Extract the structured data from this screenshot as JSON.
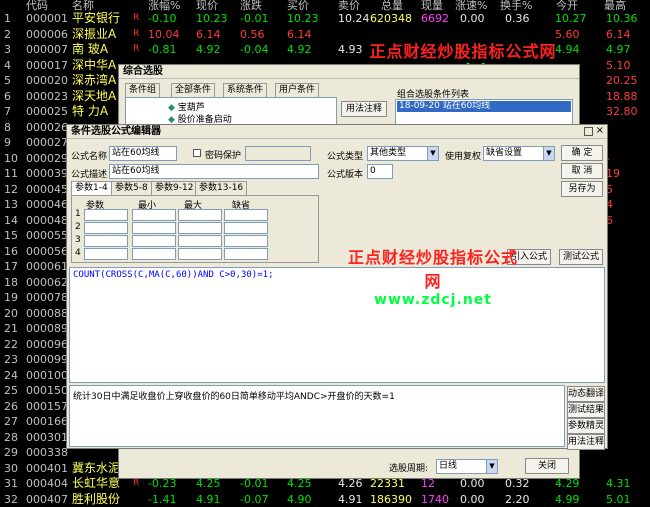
{
  "table": {
    "headers": [
      "代码",
      "名称",
      "涨幅%",
      "现价",
      "涨跌",
      "买价",
      "卖价",
      "总量",
      "现量",
      "涨速%",
      "换手%",
      "今开",
      "最高"
    ],
    "rows": [
      {
        "idx": "1",
        "code": "000001",
        "name": "平安银行",
        "r": "R",
        "chg": "-0.10",
        "price": "10.23",
        "diff": "-0.01",
        "bid": "10.23",
        "ask": "10.24",
        "vol": "620348",
        "cur": "6692",
        "spd": "0.00",
        "turn": "0.36",
        "open": "10.27",
        "high": "10.36"
      },
      {
        "idx": "2",
        "code": "000006",
        "name": "深振业A",
        "r": "R",
        "chg": "10.04",
        "price": "6.14",
        "diff": "0.56",
        "bid": "6.14",
        "ask": "",
        "vol": "",
        "cur": "",
        "spd": "",
        "turn": "",
        "open": "5.60",
        "high": "6.14"
      },
      {
        "idx": "3",
        "code": "000007",
        "name": "南 玻A",
        "r": "R",
        "chg": "-0.81",
        "price": "4.92",
        "diff": "-0.04",
        "bid": "4.92",
        "ask": "4.93",
        "vol": "",
        "cur": "",
        "spd": "",
        "turn": "",
        "open": "4.94",
        "high": "4.97"
      },
      {
        "idx": "4",
        "code": "000017",
        "name": "深中华A",
        "r": "",
        "chg": "",
        "price": "",
        "diff": "",
        "bid": "",
        "ask": "",
        "vol": "",
        "cur": "",
        "spd": "",
        "turn": "",
        "open": "",
        "high": "5.10"
      },
      {
        "idx": "5",
        "code": "000020",
        "name": "深赤湾A",
        "r": "",
        "chg": "",
        "price": "",
        "diff": "",
        "bid": "",
        "ask": "",
        "vol": "",
        "cur": "",
        "spd": "",
        "turn": "",
        "open": "",
        "high": "20.25"
      },
      {
        "idx": "6",
        "code": "000023",
        "name": "深天地A",
        "r": "",
        "chg": "",
        "price": "",
        "diff": "",
        "bid": "",
        "ask": "",
        "vol": "",
        "cur": "",
        "spd": "",
        "turn": "",
        "open": "",
        "high": "18.88"
      },
      {
        "idx": "7",
        "code": "000025",
        "name": "特 力A",
        "r": "",
        "chg": "",
        "price": "",
        "diff": "",
        "bid": "",
        "ask": "",
        "vol": "",
        "cur": "",
        "spd": "",
        "turn": "",
        "open": "",
        "high": "32.80"
      },
      {
        "idx": "8",
        "code": "000026",
        "name": "",
        "r": "",
        "chg": "",
        "price": "",
        "diff": "",
        "bid": "",
        "ask": "",
        "vol": "",
        "cur": "",
        "spd": "",
        "turn": "",
        "open": "",
        "high": ""
      },
      {
        "idx": "9",
        "code": "000027",
        "name": "",
        "r": "",
        "chg": "",
        "price": "",
        "diff": "",
        "bid": "",
        "ask": "",
        "vol": "",
        "cur": "",
        "spd": "",
        "turn": "",
        "open": "",
        "high": ""
      },
      {
        "idx": "10",
        "code": "000029",
        "name": "",
        "r": "",
        "chg": "",
        "price": "",
        "diff": "",
        "bid": "",
        "ask": "",
        "vol": "",
        "cur": "",
        "spd": "",
        "turn": "",
        "open": "",
        "high": "-"
      },
      {
        "idx": "11",
        "code": "000039",
        "name": "",
        "r": "",
        "chg": "",
        "price": "",
        "diff": "",
        "bid": "",
        "ask": "",
        "vol": "",
        "cur": "",
        "spd": "",
        "turn": "",
        "open": "",
        "high": "19"
      },
      {
        "idx": "12",
        "code": "000045",
        "name": "",
        "r": "",
        "chg": "",
        "price": "",
        "diff": "",
        "bid": "",
        "ask": "",
        "vol": "",
        "cur": "",
        "spd": "",
        "turn": "",
        "open": "",
        "high": "5"
      },
      {
        "idx": "13",
        "code": "000046",
        "name": "",
        "r": "",
        "chg": "",
        "price": "",
        "diff": "",
        "bid": "",
        "ask": "",
        "vol": "",
        "cur": "",
        "spd": "",
        "turn": "",
        "open": "",
        "high": "4"
      },
      {
        "idx": "14",
        "code": "000048",
        "name": "",
        "r": "",
        "chg": "",
        "price": "",
        "diff": "",
        "bid": "",
        "ask": "",
        "vol": "",
        "cur": "",
        "spd": "",
        "turn": "",
        "open": "",
        "high": "6"
      },
      {
        "idx": "15",
        "code": "000055",
        "name": "",
        "r": "",
        "chg": "",
        "price": "",
        "diff": "",
        "bid": "",
        "ask": "",
        "vol": "",
        "cur": "",
        "spd": "",
        "turn": "",
        "open": "",
        "high": ""
      },
      {
        "idx": "16",
        "code": "000056",
        "name": "",
        "r": "",
        "chg": "",
        "price": "",
        "diff": "",
        "bid": "",
        "ask": "",
        "vol": "",
        "cur": "",
        "spd": "",
        "turn": "",
        "open": "",
        "high": ""
      },
      {
        "idx": "17",
        "code": "000061",
        "name": "",
        "r": "",
        "chg": "",
        "price": "",
        "diff": "",
        "bid": "",
        "ask": "",
        "vol": "",
        "cur": "",
        "spd": "",
        "turn": "",
        "open": "",
        "high": ""
      },
      {
        "idx": "18",
        "code": "000062",
        "name": "",
        "r": "",
        "chg": "",
        "price": "",
        "diff": "",
        "bid": "",
        "ask": "",
        "vol": "",
        "cur": "",
        "spd": "",
        "turn": "",
        "open": "",
        "high": ""
      },
      {
        "idx": "19",
        "code": "000078",
        "name": "",
        "r": "",
        "chg": "",
        "price": "",
        "diff": "",
        "bid": "",
        "ask": "",
        "vol": "",
        "cur": "",
        "spd": "",
        "turn": "",
        "open": "",
        "high": ""
      },
      {
        "idx": "20",
        "code": "000088",
        "name": "",
        "r": "",
        "chg": "",
        "price": "",
        "diff": "",
        "bid": "",
        "ask": "",
        "vol": "",
        "cur": "",
        "spd": "",
        "turn": "",
        "open": "",
        "high": ""
      },
      {
        "idx": "21",
        "code": "000089",
        "name": "",
        "r": "",
        "chg": "",
        "price": "",
        "diff": "",
        "bid": "",
        "ask": "",
        "vol": "",
        "cur": "",
        "spd": "",
        "turn": "",
        "open": "",
        "high": ""
      },
      {
        "idx": "22",
        "code": "000096",
        "name": "",
        "r": "",
        "chg": "",
        "price": "",
        "diff": "",
        "bid": "",
        "ask": "",
        "vol": "",
        "cur": "",
        "spd": "",
        "turn": "",
        "open": "",
        "high": ""
      },
      {
        "idx": "23",
        "code": "000099",
        "name": "",
        "r": "",
        "chg": "",
        "price": "",
        "diff": "",
        "bid": "",
        "ask": "",
        "vol": "",
        "cur": "",
        "spd": "",
        "turn": "",
        "open": "",
        "high": ""
      },
      {
        "idx": "24",
        "code": "000100",
        "name": "",
        "r": "",
        "chg": "",
        "price": "",
        "diff": "",
        "bid": "",
        "ask": "",
        "vol": "",
        "cur": "",
        "spd": "",
        "turn": "",
        "open": "",
        "high": ""
      },
      {
        "idx": "25",
        "code": "000150",
        "name": "",
        "r": "",
        "chg": "",
        "price": "",
        "diff": "",
        "bid": "",
        "ask": "",
        "vol": "",
        "cur": "",
        "spd": "",
        "turn": "",
        "open": "",
        "high": ""
      },
      {
        "idx": "26",
        "code": "000157",
        "name": "",
        "r": "",
        "chg": "",
        "price": "",
        "diff": "",
        "bid": "",
        "ask": "",
        "vol": "",
        "cur": "",
        "spd": "",
        "turn": "",
        "open": "",
        "high": ""
      },
      {
        "idx": "27",
        "code": "000166",
        "name": "",
        "r": "",
        "chg": "",
        "price": "",
        "diff": "",
        "bid": "",
        "ask": "",
        "vol": "",
        "cur": "",
        "spd": "",
        "turn": "",
        "open": "",
        "high": ""
      },
      {
        "idx": "28",
        "code": "000301",
        "name": "",
        "r": "",
        "chg": "",
        "price": "",
        "diff": "",
        "bid": "",
        "ask": "",
        "vol": "",
        "cur": "",
        "spd": "",
        "turn": "",
        "open": "",
        "high": ""
      },
      {
        "idx": "29",
        "code": "000338",
        "name": "",
        "r": "",
        "chg": "",
        "price": "",
        "diff": "",
        "bid": "",
        "ask": "",
        "vol": "",
        "cur": "",
        "spd": "",
        "turn": "",
        "open": "",
        "high": ""
      },
      {
        "idx": "30",
        "code": "000401",
        "name": "冀东水泥",
        "r": "",
        "chg": "",
        "price": "",
        "diff": "",
        "bid": "",
        "ask": "",
        "vol": "",
        "cur": "",
        "spd": "",
        "turn": "",
        "open": "",
        "high": ""
      },
      {
        "idx": "31",
        "code": "000404",
        "name": "长虹华意",
        "r": "R",
        "chg": "-0.23",
        "price": "4.25",
        "diff": "-0.01",
        "bid": "4.25",
        "ask": "4.26",
        "vol": "22331",
        "cur": "12",
        "spd": "0.00",
        "turn": "0.32",
        "open": "4.29",
        "high": "4.31"
      },
      {
        "idx": "32",
        "code": "000407",
        "name": "胜利股份",
        "r": "",
        "chg": "-1.41",
        "price": "4.91",
        "diff": "-0.07",
        "bid": "4.90",
        "ask": "4.91",
        "vol": "186390",
        "cur": "1740",
        "spd": "0.00",
        "turn": "2.20",
        "open": "4.99",
        "high": "5.01"
      }
    ]
  },
  "watermark": {
    "line1": "正点财经炒股指标公式网",
    "line2": "www.zdcj.net"
  },
  "zhxg": {
    "title": "综合选股",
    "tabs": [
      "条件组",
      "全部条件",
      "系统条件",
      "用户条件"
    ],
    "tree": [
      "宝葫芦",
      "股价准备启动"
    ],
    "usage_btn": "用法注释",
    "combo_label": "组合选股条件列表",
    "combo_item": "18-09-20 站在60均线"
  },
  "editor": {
    "title": "条件选股公式编辑器",
    "name_label": "公式名称",
    "name_value": "站在60均线",
    "pwd_label": "密码保护",
    "type_label": "公式类型",
    "type_value": "其他类型",
    "right_label": "使用复权",
    "right_value": "缺省设置",
    "ok": "确  定",
    "cancel": "取  消",
    "saveas": "另存为",
    "desc_label": "公式描述",
    "desc_value": "站在60均线",
    "ver_label": "公式版本",
    "ver_value": "0",
    "param_tabs": [
      "参数1-4",
      "参数5-8",
      "参数9-12",
      "参数13-16"
    ],
    "param_headers": [
      "参数",
      "最小",
      "最大",
      "缺省"
    ],
    "param_rows": [
      "1",
      "2",
      "3",
      "4"
    ],
    "import_btn": "引入公式",
    "test_btn": "测试公式",
    "code": "COUNT(CROSS(C,MA(C,60))AND C>0,30)=1;",
    "desc_text": "统计30日中满足收盘价上穿收盘价的60日简单移动平均ANDC>开盘价的天数=1",
    "side_btns": [
      "动态翻译",
      "测试结果",
      "参数精灵",
      "用法注释"
    ]
  },
  "footer": {
    "period_label": "选股周期:",
    "period_value": "日线",
    "close": "关闭"
  }
}
